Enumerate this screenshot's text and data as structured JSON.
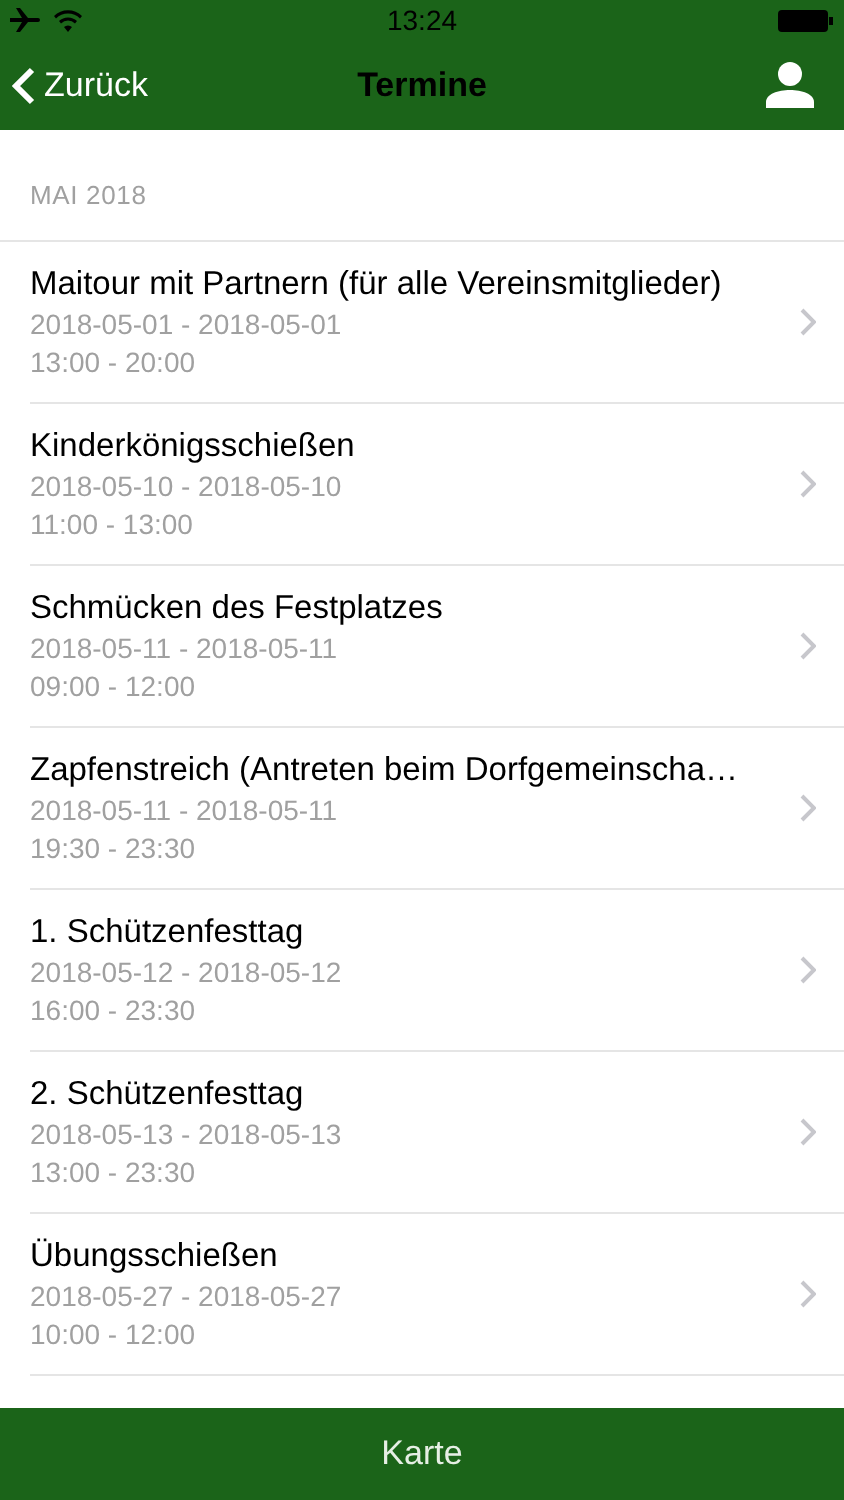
{
  "status_bar": {
    "time": "13:24"
  },
  "nav": {
    "back": "Zurück",
    "title": "Termine"
  },
  "section": "MAI 2018",
  "events": [
    {
      "title": "Maitour mit Partnern (für alle Vereinsmitglieder)",
      "dates": "2018-05-01 - 2018-05-01",
      "time": "13:00 - 20:00"
    },
    {
      "title": "Kinderkönigsschießen",
      "dates": "2018-05-10 - 2018-05-10",
      "time": "11:00 - 13:00"
    },
    {
      "title": "Schmücken des Festplatzes",
      "dates": "2018-05-11 - 2018-05-11",
      "time": "09:00 - 12:00"
    },
    {
      "title": "Zapfenstreich (Antreten beim Dorfgemeinscha…",
      "dates": "2018-05-11 - 2018-05-11",
      "time": "19:30 - 23:30"
    },
    {
      "title": "1. Schützenfesttag",
      "dates": "2018-05-12 - 2018-05-12",
      "time": "16:00 - 23:30"
    },
    {
      "title": "2. Schützenfesttag",
      "dates": "2018-05-13 - 2018-05-13",
      "time": "13:00 - 23:30"
    },
    {
      "title": "Übungsschießen",
      "dates": "2018-05-27 - 2018-05-27",
      "time": "10:00 - 12:00"
    }
  ],
  "bottom_button": "Karte"
}
